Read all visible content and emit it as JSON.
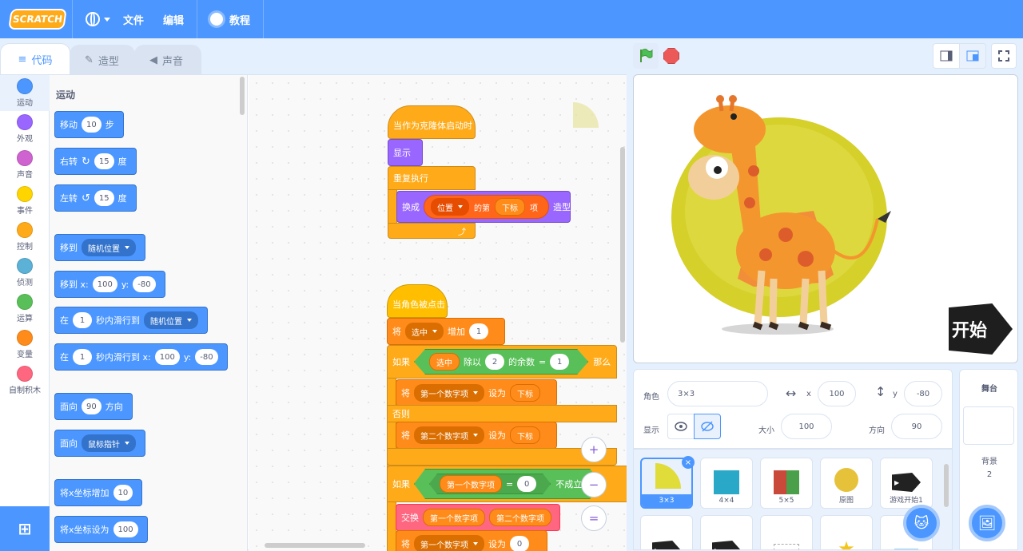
{
  "menu": {
    "logo": "SCRATCH",
    "file": "文件",
    "edit": "编辑",
    "tutorials": "教程"
  },
  "tabs": {
    "code": "代码",
    "costumes": "造型",
    "sounds": "声音"
  },
  "categories": [
    {
      "label": "运动",
      "color": "#4c97ff"
    },
    {
      "label": "外观",
      "color": "#9966ff"
    },
    {
      "label": "声音",
      "color": "#cf63cf"
    },
    {
      "label": "事件",
      "color": "#ffd500"
    },
    {
      "label": "控制",
      "color": "#ffab19"
    },
    {
      "label": "侦测",
      "color": "#5cb1d6"
    },
    {
      "label": "运算",
      "color": "#59c059"
    },
    {
      "label": "变量",
      "color": "#ff8c1a"
    },
    {
      "label": "自制积木",
      "color": "#ff6680"
    }
  ],
  "palette": {
    "title": "运动",
    "move": {
      "a": "移动",
      "n": "10",
      "b": "步"
    },
    "turn_right": {
      "a": "右转",
      "icon": "↻",
      "n": "15",
      "b": "度"
    },
    "turn_left": {
      "a": "左转",
      "icon": "↺",
      "n": "15",
      "b": "度"
    },
    "goto": {
      "a": "移到",
      "dd": "随机位置"
    },
    "goto_xy": {
      "a": "移到 x:",
      "x": "100",
      "yl": "y:",
      "y": "-80"
    },
    "glide": {
      "a": "在",
      "n": "1",
      "b": "秒内滑行到",
      "dd": "随机位置"
    },
    "glide_xy": {
      "a": "在",
      "n": "1",
      "b": "秒内滑行到 x:",
      "x": "100",
      "yl": "y:",
      "y": "-80"
    },
    "point_dir": {
      "a": "面向",
      "n": "90",
      "b": "方向"
    },
    "point_towards": {
      "a": "面向",
      "dd": "鼠标指针"
    },
    "change_x": {
      "a": "将x坐标增加",
      "n": "10"
    },
    "set_x": {
      "a": "将x坐标设为",
      "n": "100"
    }
  },
  "script": {
    "clone_hat": "当作为克隆体启动时",
    "show": "显示",
    "forever": "重复执行",
    "switch_costume": {
      "a": "换成",
      "dd": "位置",
      "b": "的第",
      "r": "下标",
      "c": "项",
      "d": "造型"
    },
    "click_hat": "当角色被点击",
    "change_var": {
      "a": "将",
      "dd": "选中",
      "b": "增加",
      "n": "1"
    },
    "if": {
      "a": "如果",
      "r": "选中",
      "b": "除以",
      "n": "2",
      "c": "的余数",
      "eq": "=",
      "m": "1",
      "d": "那么"
    },
    "set1": {
      "a": "将",
      "dd": "第一个数字项",
      "b": "设为",
      "r": "下标"
    },
    "else": "否则",
    "set2": {
      "a": "将",
      "dd": "第二个数字项",
      "b": "设为",
      "r": "下标"
    },
    "if2": {
      "a": "如果",
      "r": "第一个数字项",
      "eq": "=",
      "n": "0",
      "b": "不成立"
    },
    "swap": {
      "a": "交换",
      "r1": "第一个数字项",
      "r2": "第二个数字项"
    },
    "set3": {
      "a": "将",
      "dd": "第一个数字项",
      "b": "设为",
      "n": "0"
    }
  },
  "zoom": {
    "in": "+",
    "out": "−",
    "reset": "="
  },
  "sprite_info": {
    "sprite_label": "角色",
    "sprite_name": "3×3",
    "x_label": "x",
    "x": "100",
    "y_label": "y",
    "y": "-80",
    "show_label": "显示",
    "size_label": "大小",
    "size": "100",
    "direction_label": "方向",
    "direction": "90"
  },
  "sprites": [
    {
      "name": "3×3",
      "selected": true
    },
    {
      "name": "4×4"
    },
    {
      "name": "5×5"
    },
    {
      "name": "原图"
    },
    {
      "name": "游戏开始1"
    },
    {
      "name": ""
    },
    {
      "name": ""
    },
    {
      "name": ""
    },
    {
      "name": ""
    },
    {
      "name": ""
    }
  ],
  "stage_pane": {
    "title": "舞台",
    "backdrops_label": "背景",
    "backdrops_count": "2"
  },
  "stage": {
    "start_badge": "开始"
  }
}
